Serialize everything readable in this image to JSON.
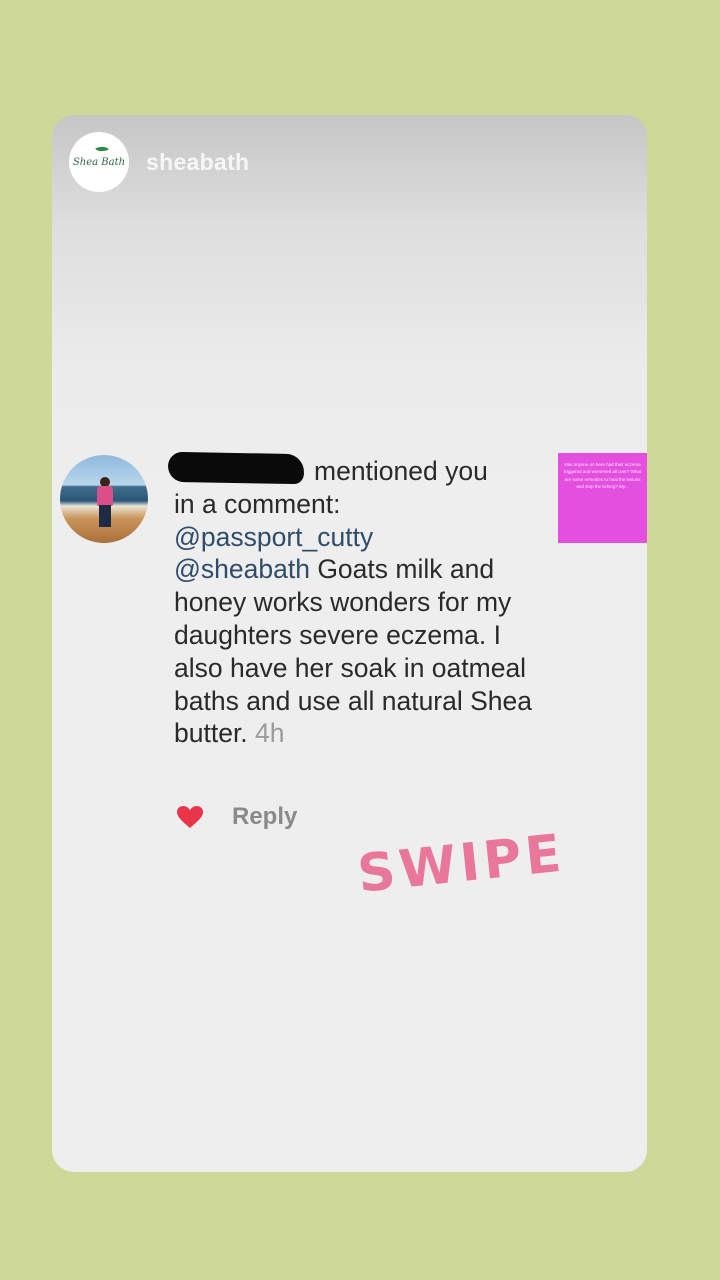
{
  "story": {
    "account_name": "sheabath",
    "logo_text": "Shea Bath"
  },
  "comment": {
    "mentioned_text": "mentioned you",
    "in_a_comment": "in a comment:",
    "mention_1": "@passport_cutty",
    "mention_2": "@sheabath",
    "body": " Goats milk and honey works wonders for my daughters severe eczema. I also have her soak in oatmeal baths and use all natural Shea butter.",
    "time": "4h"
  },
  "actions": {
    "reply_label": "Reply",
    "heart_icon": "heart-icon",
    "heart_color": "#e8354a"
  },
  "thumbnail": {
    "text": "Has anyone on here had their eczema triggered and worsened all over? What are some remedies to heal the lesions and stop the itching? My..."
  },
  "overlay": {
    "swipe_text": "SWIPE",
    "swipe_color": "#e8779a"
  },
  "colors": {
    "page_background": "#cdd899",
    "thumbnail_background": "#e44fe0"
  }
}
